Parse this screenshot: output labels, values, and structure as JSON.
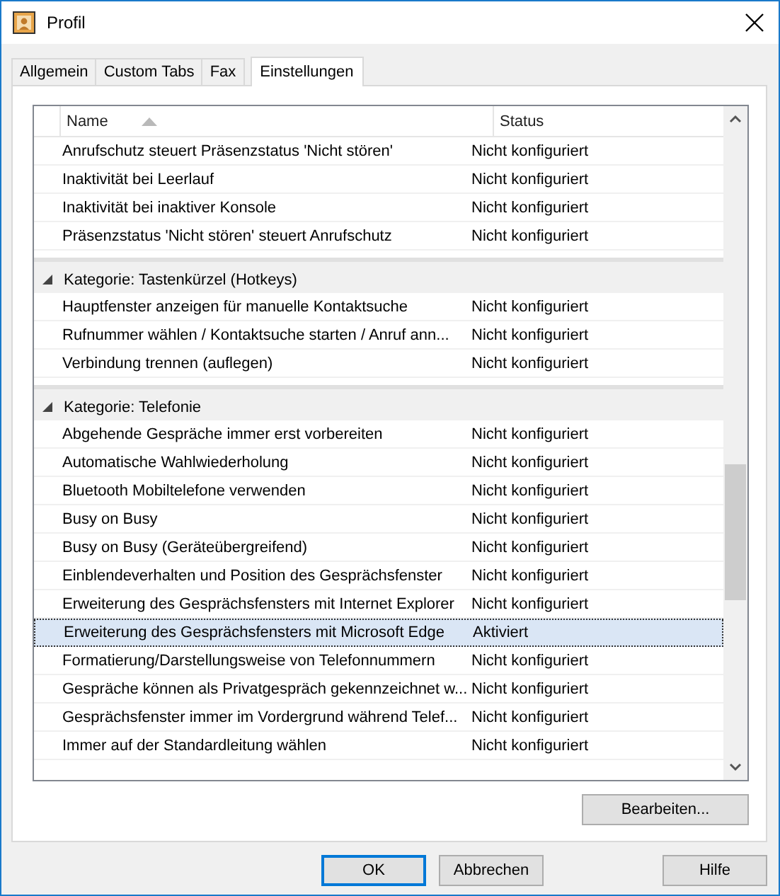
{
  "window": {
    "title": "Profil"
  },
  "tabs": [
    {
      "label": "Allgemein",
      "selected": false
    },
    {
      "label": "Custom Tabs",
      "selected": false
    },
    {
      "label": "Fax",
      "selected": false
    },
    {
      "label": "Einstellungen",
      "selected": true
    }
  ],
  "table": {
    "columns": [
      {
        "label": "Name",
        "sorted": true
      },
      {
        "label": "Status",
        "sorted": false
      }
    ],
    "groups": [
      {
        "items": [
          {
            "name": "Anrufschutz steuert Präsenzstatus 'Nicht stören'",
            "status": "Nicht konfiguriert",
            "selected": false
          },
          {
            "name": "Inaktivität bei Leerlauf",
            "status": "Nicht konfiguriert",
            "selected": false
          },
          {
            "name": "Inaktivität bei inaktiver Konsole",
            "status": "Nicht konfiguriert",
            "selected": false
          },
          {
            "name": "Präsenzstatus 'Nicht stören' steuert Anrufschutz",
            "status": "Nicht konfiguriert",
            "selected": false
          }
        ]
      },
      {
        "title": "Kategorie: Tastenkürzel (Hotkeys)",
        "expanded": true,
        "items": [
          {
            "name": "Hauptfenster anzeigen für manuelle Kontaktsuche",
            "status": "Nicht konfiguriert",
            "selected": false
          },
          {
            "name": "Rufnummer wählen / Kontaktsuche starten / Anruf ann...",
            "status": "Nicht konfiguriert",
            "selected": false
          },
          {
            "name": "Verbindung trennen (auflegen)",
            "status": "Nicht konfiguriert",
            "selected": false
          }
        ]
      },
      {
        "title": "Kategorie: Telefonie",
        "expanded": true,
        "items": [
          {
            "name": "Abgehende Gespräche immer erst vorbereiten",
            "status": "Nicht konfiguriert",
            "selected": false
          },
          {
            "name": "Automatische Wahlwiederholung",
            "status": "Nicht konfiguriert",
            "selected": false
          },
          {
            "name": "Bluetooth Mobiltelefone verwenden",
            "status": "Nicht konfiguriert",
            "selected": false
          },
          {
            "name": "Busy on Busy",
            "status": "Nicht konfiguriert",
            "selected": false
          },
          {
            "name": "Busy on Busy (Geräteübergreifend)",
            "status": "Nicht konfiguriert",
            "selected": false
          },
          {
            "name": "Einblendeverhalten und Position des Gesprächsfenster",
            "status": "Nicht konfiguriert",
            "selected": false
          },
          {
            "name": "Erweiterung des Gesprächsfensters mit Internet Explorer",
            "status": "Nicht konfiguriert",
            "selected": false
          },
          {
            "name": "Erweiterung des Gesprächsfensters mit Microsoft Edge",
            "status": "Aktiviert",
            "selected": true
          },
          {
            "name": "Formatierung/Darstellungsweise von Telefonnummern",
            "status": "Nicht konfiguriert",
            "selected": false
          },
          {
            "name": "Gespräche können als Privatgespräch gekennzeichnet w...",
            "status": "Nicht konfiguriert",
            "selected": false
          },
          {
            "name": "Gesprächsfenster immer im Vordergrund während Telef...",
            "status": "Nicht konfiguriert",
            "selected": false
          },
          {
            "name": "Immer auf der Standardleitung wählen",
            "status": "Nicht konfiguriert",
            "selected": false
          }
        ]
      }
    ]
  },
  "edit_button": "Bearbeiten...",
  "buttons": [
    {
      "label": "OK",
      "default": true
    },
    {
      "label": "Abbrechen",
      "default": false
    },
    {
      "label": "Hilfe",
      "default": false
    }
  ]
}
